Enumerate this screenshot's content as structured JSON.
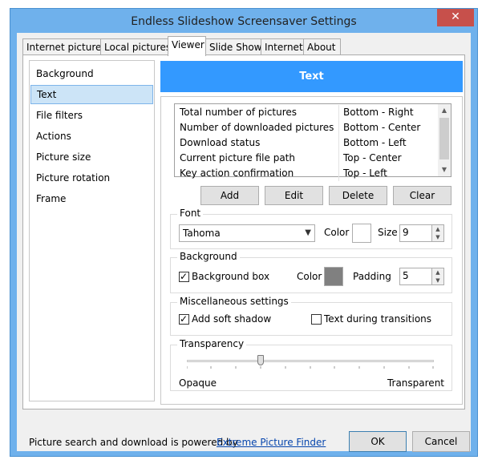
{
  "window": {
    "title": "Endless Slideshow Screensaver Settings",
    "close_glyph": "✕"
  },
  "tabs": [
    {
      "label": "Internet pictures",
      "active": false
    },
    {
      "label": "Local pictures",
      "active": false
    },
    {
      "label": "Viewer",
      "active": true
    },
    {
      "label": "Slide Show",
      "active": false
    },
    {
      "label": "Internet",
      "active": false
    },
    {
      "label": "About",
      "active": false
    }
  ],
  "sidebar": {
    "items": [
      {
        "label": "Background",
        "selected": false
      },
      {
        "label": "Text",
        "selected": true
      },
      {
        "label": "File filters",
        "selected": false
      },
      {
        "label": "Actions",
        "selected": false
      },
      {
        "label": "Picture size",
        "selected": false
      },
      {
        "label": "Picture rotation",
        "selected": false
      },
      {
        "label": "Frame",
        "selected": false
      }
    ]
  },
  "section": {
    "title": "Text",
    "header_color": "#3399ff"
  },
  "text_items": [
    {
      "name": "Total number of pictures",
      "position": "Bottom - Right"
    },
    {
      "name": "Number of downloaded pictures",
      "position": "Bottom - Center"
    },
    {
      "name": "Download status",
      "position": "Bottom - Left"
    },
    {
      "name": "Current picture file path",
      "position": "Top - Center"
    },
    {
      "name": "Key action confirmation",
      "position": "Top - Left"
    }
  ],
  "list_buttons": {
    "add": "Add",
    "edit": "Edit",
    "delete": "Delete",
    "clear": "Clear"
  },
  "font": {
    "group_label": "Font",
    "family": "Tahoma",
    "color_label": "Color",
    "color_value": "#ffffff",
    "size_label": "Size",
    "size_value": "9"
  },
  "background": {
    "group_label": "Background",
    "box_label": "Background box",
    "box_checked": true,
    "color_label": "Color",
    "color_value": "#808080",
    "padding_label": "Padding",
    "padding_value": "5"
  },
  "misc": {
    "group_label": "Miscellaneous settings",
    "soft_shadow_label": "Add soft shadow",
    "soft_shadow_checked": true,
    "transitions_label": "Text during transitions",
    "transitions_checked": false
  },
  "transparency": {
    "group_label": "Transparency",
    "min_label": "Opaque",
    "max_label": "Transparent",
    "level": 0.3
  },
  "footer": {
    "text": "Picture search and download is powered by",
    "link": "Extreme Picture Finder",
    "ok": "OK",
    "cancel": "Cancel"
  }
}
